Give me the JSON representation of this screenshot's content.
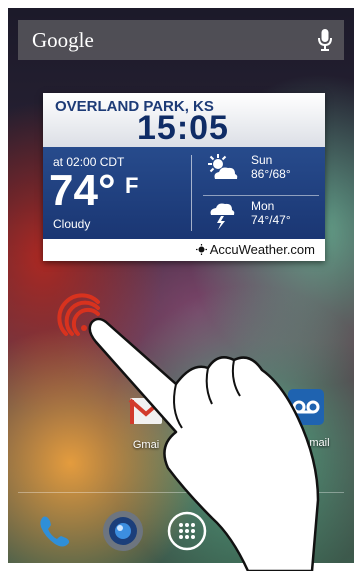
{
  "search": {
    "label": "Google",
    "mic_icon": "microphone-icon"
  },
  "weather": {
    "city": "OVERLAND PARK, KS",
    "time": "15:05",
    "observed_at": "at 02:00 CDT",
    "temperature": "74°",
    "unit": "F",
    "condition": "Cloudy",
    "forecast": [
      {
        "day": "Sun",
        "temps": "86°/68°",
        "icon": "partly-sunny-icon"
      },
      {
        "day": "Mon",
        "temps": "74°/47°",
        "icon": "thunderstorm-icon"
      }
    ],
    "brand": "AccuWeather.com"
  },
  "apps": [
    {
      "label": "Gmai",
      "icon": "gmail-icon"
    },
    {
      "label": "Voicemail",
      "icon": "voicemail-icon"
    }
  ],
  "dock": [
    "phone-icon",
    "camera-icon",
    "app-drawer-icon",
    "messaging-icon"
  ],
  "colors": {
    "weather_blue": "#1a3673",
    "nfc_red": "#d8321e",
    "dock_green": "#8bc34a"
  }
}
